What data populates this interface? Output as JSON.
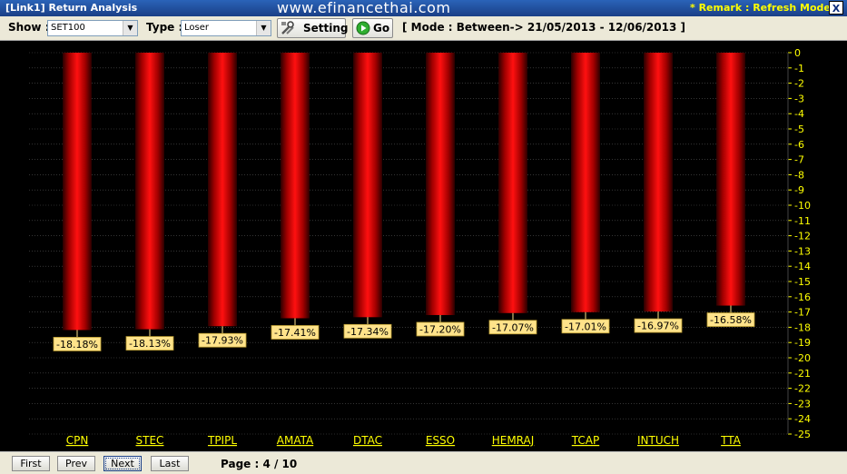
{
  "title_bar": {
    "title": "[Link1] Return Analysis",
    "watermark": "www.efinancethai.com",
    "remark": "* Remark : Refresh Mode",
    "close_label": "X"
  },
  "toolbar": {
    "show_label": "Show :",
    "show_value": "SET100",
    "type_label": "Type :",
    "type_value": "Loser",
    "setting_label": "Setting",
    "go_label": "Go",
    "mode_text": "[ Mode : Between-> 21/05/2013 - 12/06/2013 ]"
  },
  "chart_data": {
    "type": "bar",
    "categories": [
      "CPN",
      "STEC",
      "TPIPL",
      "AMATA",
      "DTAC",
      "ESSO",
      "HEMRAJ",
      "TCAP",
      "INTUCH",
      "TTA"
    ],
    "values": [
      -18.18,
      -18.13,
      -17.93,
      -17.41,
      -17.34,
      -17.2,
      -17.07,
      -17.01,
      -16.97,
      -16.58
    ],
    "data_labels": [
      "-18.18%",
      "-18.13%",
      "-17.93%",
      "-17.41%",
      "-17.34%",
      "-17.20%",
      "-17.07%",
      "-17.01%",
      "-16.97%",
      "-16.58%"
    ],
    "ylim": [
      -25,
      0
    ],
    "yticks": [
      "0",
      "-1",
      "-2",
      "-3",
      "-4",
      "-5",
      "-6",
      "-7",
      "-8",
      "-9",
      "-10",
      "-11",
      "-12",
      "-13",
      "-14",
      "-15",
      "-16",
      "-17",
      "-18",
      "-19",
      "-20",
      "-21",
      "-22",
      "-23",
      "-24",
      "-25"
    ],
    "grid": true,
    "colors": {
      "background": "#000000",
      "bar": "#ff0000",
      "bar_edge": "#2a0000",
      "tick_text": "#ffff00",
      "category_text": "#ffff00",
      "label_bg": "#ffe38a",
      "grid": "#555555"
    }
  },
  "footer": {
    "first_label": "First",
    "prev_label": "Prev",
    "next_label": "Next",
    "last_label": "Last",
    "page_text": "Page : 4 / 10"
  }
}
